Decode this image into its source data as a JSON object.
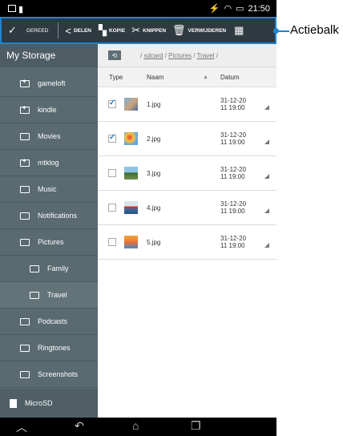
{
  "status": {
    "time": "21:50"
  },
  "actionbar": {
    "done_label": "GEREED",
    "share_label": "DELEN",
    "copy_label": "KOPIE",
    "cut_label": "KNIPPEN",
    "delete_label": "VERWIJDEREN"
  },
  "callout": {
    "label": "Actiebalk"
  },
  "sidebar": {
    "title": "My Storage",
    "items": [
      {
        "label": "gameloft"
      },
      {
        "label": "kindle"
      },
      {
        "label": "Movies"
      },
      {
        "label": "mtklog"
      },
      {
        "label": "Music"
      },
      {
        "label": "Notifications"
      },
      {
        "label": "Pictures"
      },
      {
        "label": "Family"
      },
      {
        "label": "Travel"
      },
      {
        "label": "Podcasts"
      },
      {
        "label": "Ringtones"
      },
      {
        "label": "Screenshots"
      },
      {
        "label": "MicroSD"
      }
    ]
  },
  "main": {
    "path_prefix": "/ ",
    "path_sdcard": "sdcard",
    "path_sep": " / ",
    "path_pictures": "Pictures",
    "path_travel": "Travel",
    "path_suffix": " /",
    "columns": {
      "type": "Type",
      "name": "Naam",
      "date": "Datum"
    },
    "files": [
      {
        "name": "1.jpg",
        "date1": "31-12-20",
        "date2": "11 19:00",
        "checked": true
      },
      {
        "name": "2.jpg",
        "date1": "31-12-20",
        "date2": "11 19:00",
        "checked": true
      },
      {
        "name": "3.jpg",
        "date1": "31-12-20",
        "date2": "11 19:00",
        "checked": false
      },
      {
        "name": "4.jpg",
        "date1": "31-12-20",
        "date2": "11 19:00",
        "checked": false
      },
      {
        "name": "5.jpg",
        "date1": "31-12-20",
        "date2": "11 19:00",
        "checked": false
      }
    ]
  },
  "colors": {
    "accent": "#1c86d1",
    "sidebar": "#596a70",
    "actionbar": "#2f3940"
  }
}
